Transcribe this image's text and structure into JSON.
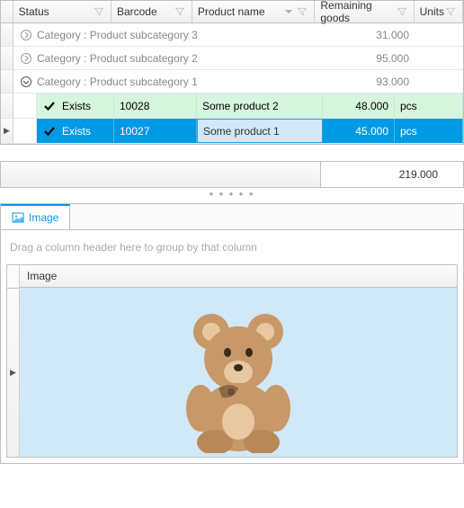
{
  "columns": {
    "status": "Status",
    "barcode": "Barcode",
    "product_name": "Product name",
    "remaining": "Remaining goods",
    "units": "Units"
  },
  "groups": [
    {
      "label": "Category : Product subcategory 3",
      "value": "31.000",
      "expanded": false
    },
    {
      "label": "Category : Product subcategory 2",
      "value": "95.000",
      "expanded": false
    },
    {
      "label": "Category : Product subcategory 1",
      "value": "93.000",
      "expanded": true
    }
  ],
  "rows": [
    {
      "status": "Exists",
      "barcode": "10028",
      "product": "Some product 2",
      "remaining": "48.000",
      "units": "pcs",
      "variant": "green"
    },
    {
      "status": "Exists",
      "barcode": "10027",
      "product": "Some product 1",
      "remaining": "45.000",
      "units": "pcs",
      "variant": "blue"
    }
  ],
  "total": "219.000",
  "tab": {
    "label": "Image"
  },
  "group_hint": "Drag a column header here to group by that column",
  "detail_column": "Image",
  "image_alt": "teddy-bear"
}
